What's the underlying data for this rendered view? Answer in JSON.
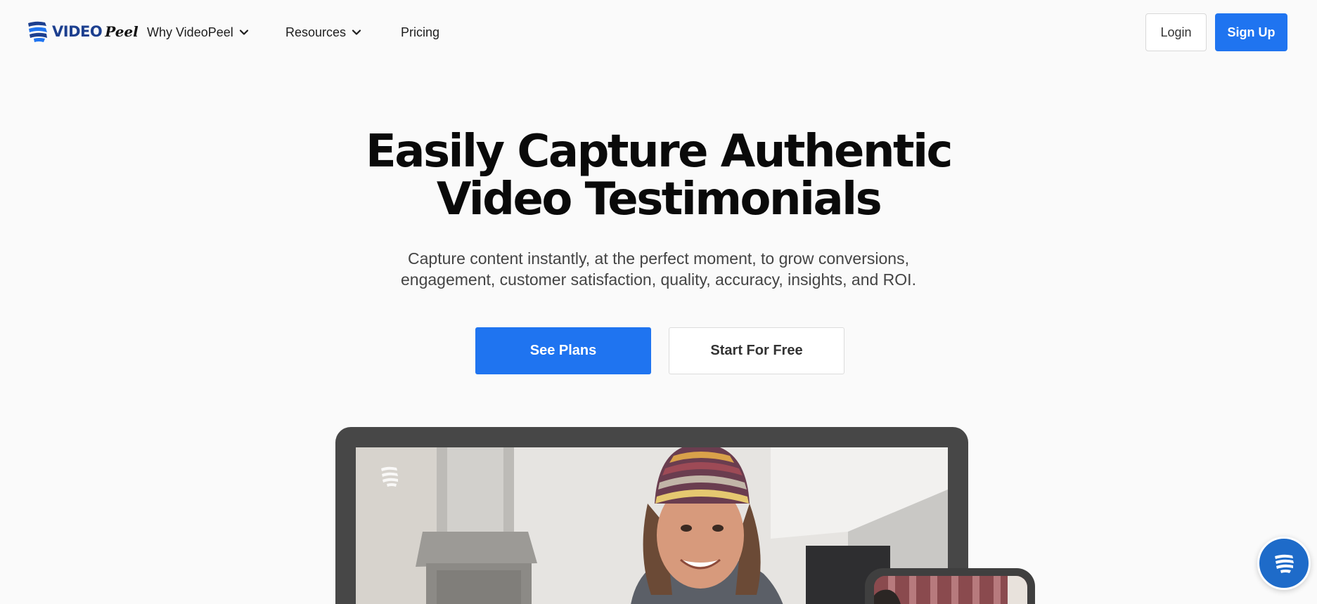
{
  "header": {
    "logo": {
      "text": "VIDEO",
      "script": "Peel",
      "icon": "videopeel-logo-icon"
    },
    "nav": [
      {
        "label": "Why VideoPeel",
        "has_dropdown": true
      },
      {
        "label": "Resources",
        "has_dropdown": true
      },
      {
        "label": "Pricing",
        "has_dropdown": false
      }
    ],
    "login_label": "Login",
    "signup_label": "Sign Up"
  },
  "hero": {
    "title_line1": "Easily Capture Authentic",
    "title_line2": "Video Testimonials",
    "subtitle_line1": "Capture content instantly, at the perfect moment, to grow conversions,",
    "subtitle_line2": "engagement, customer satisfaction, quality, accuracy, insights, and ROI.",
    "primary_cta": "See Plans",
    "secondary_cta": "Start For Free"
  },
  "media": {
    "laptop_icon": "videopeel-watermark-icon",
    "phone_icon": "phone-preview"
  },
  "chat": {
    "icon": "chat-widget-icon"
  },
  "colors": {
    "accent": "#1f74f0",
    "brand_navy": "#1c3f8f",
    "chat_blue": "#1e6bc9",
    "device_frame": "#474747"
  }
}
